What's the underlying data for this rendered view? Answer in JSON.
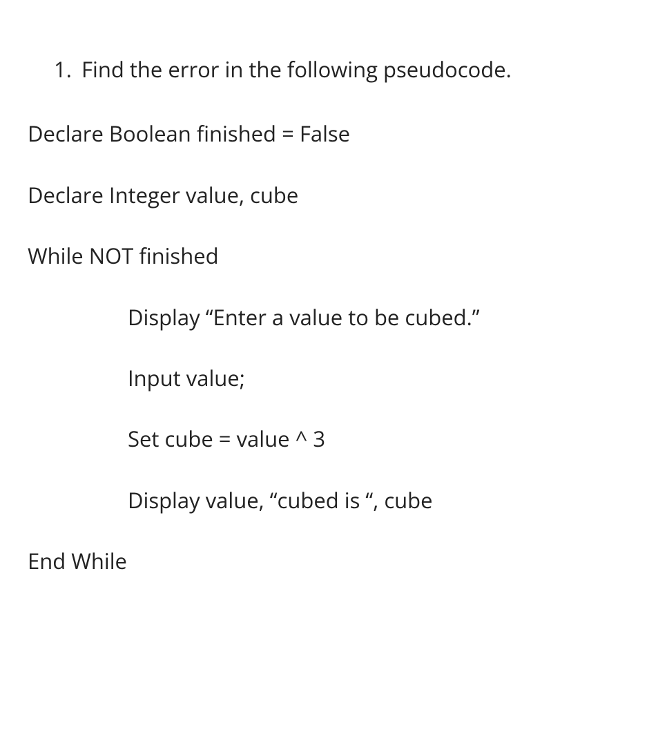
{
  "question": {
    "number": "1.",
    "text": "Find the error in the following pseudocode."
  },
  "code": {
    "line1": "Declare Boolean finished = False",
    "line2": "Declare Integer value, cube",
    "line3": "While NOT finished",
    "line4": "Display “Enter a value to be cubed.”",
    "line5": "Input value;",
    "line6": "Set cube = value ^ 3",
    "line7": "Display value, “cubed is “, cube",
    "line8": "End While"
  }
}
